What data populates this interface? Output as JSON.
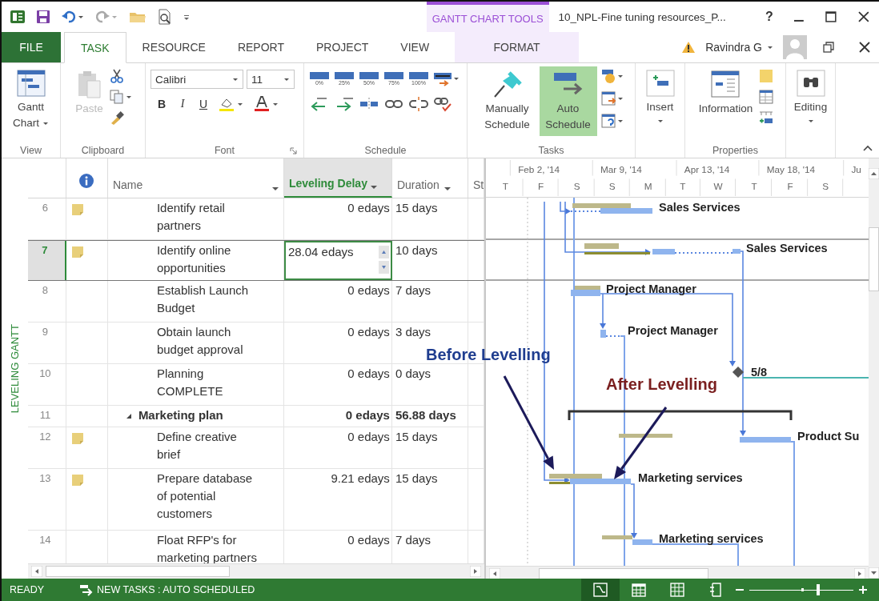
{
  "title_bar": {
    "context_label": "GANTT CHART TOOLS",
    "document_title": "10_NPL-Fine tuning resources_P...",
    "help": "?"
  },
  "tabs": [
    {
      "label": "FILE",
      "kind": "file",
      "selected": false
    },
    {
      "label": "TASK",
      "kind": "tab",
      "selected": true
    },
    {
      "label": "RESOURCE",
      "kind": "tab",
      "selected": false
    },
    {
      "label": "REPORT",
      "kind": "tab",
      "selected": false
    },
    {
      "label": "PROJECT",
      "kind": "tab",
      "selected": false
    },
    {
      "label": "VIEW",
      "kind": "tab",
      "selected": false
    },
    {
      "label": "FORMAT",
      "kind": "contextual",
      "selected": false
    }
  ],
  "account": {
    "user": "Ravindra G"
  },
  "ribbon": {
    "view": {
      "label": "View",
      "command": "Gantt Chart"
    },
    "clipboard": {
      "label": "Clipboard",
      "paste": "Paste",
      "paste_disabled": true
    },
    "font": {
      "label": "Font",
      "family": "Calibri",
      "size": "11",
      "bold": "B",
      "italic": "I",
      "underline": "U"
    },
    "schedule": {
      "label": "Schedule",
      "percents": [
        "0%",
        "25%",
        "50%",
        "75%",
        "100%"
      ]
    },
    "tasks": {
      "label": "Tasks",
      "modes": [
        {
          "label": "Manually Schedule",
          "selected": false
        },
        {
          "label": "Auto Schedule",
          "selected": true
        }
      ]
    },
    "insert": {
      "label": "Insert"
    },
    "properties": {
      "label": "Properties",
      "command": "Information"
    },
    "editing": {
      "label": "Editing"
    }
  },
  "view_bar": {
    "label": "LEVELING GANTT"
  },
  "table": {
    "columns": [
      {
        "label": "Name",
        "selected": false
      },
      {
        "label": "Leveling Delay",
        "selected": true
      },
      {
        "label": "Duration",
        "selected": false
      },
      {
        "label": "St",
        "selected": false
      }
    ],
    "rows": [
      {
        "id": "6",
        "note": true,
        "name": "Identify retail partners",
        "leveling_delay": "0 edays",
        "duration": "15 days",
        "selected": false,
        "editing": false,
        "summary": false
      },
      {
        "id": "7",
        "note": true,
        "name": "Identify online opportunities",
        "leveling_delay": "28.04 edays",
        "duration": "10 days",
        "selected": true,
        "editing": true,
        "summary": false
      },
      {
        "id": "8",
        "note": false,
        "name": "Establish Launch Budget",
        "leveling_delay": "0 edays",
        "duration": "7 days",
        "selected": false,
        "editing": false,
        "summary": false
      },
      {
        "id": "9",
        "note": false,
        "name": "Obtain launch budget approval",
        "leveling_delay": "0 edays",
        "duration": "3 days",
        "selected": false,
        "editing": false,
        "summary": false
      },
      {
        "id": "10",
        "note": false,
        "name": "Planning COMPLETE",
        "leveling_delay": "0 edays",
        "duration": "0 days",
        "selected": false,
        "editing": false,
        "summary": false
      },
      {
        "id": "11",
        "note": false,
        "name": "Marketing plan",
        "leveling_delay": "0 edays",
        "duration": "56.88 days",
        "selected": false,
        "editing": false,
        "summary": true,
        "expanded": true
      },
      {
        "id": "12",
        "note": true,
        "name": "Define creative brief",
        "leveling_delay": "0 edays",
        "duration": "15 days",
        "selected": false,
        "editing": false,
        "summary": false
      },
      {
        "id": "13",
        "note": true,
        "name": "Prepare database of potential customers",
        "leveling_delay": "9.21 edays",
        "duration": "15 days",
        "selected": false,
        "editing": false,
        "summary": false
      },
      {
        "id": "14",
        "note": false,
        "name": "Float RFP's for marketing partners",
        "leveling_delay": "0 edays",
        "duration": "7 days",
        "selected": false,
        "editing": false,
        "summary": false
      }
    ]
  },
  "gantt": {
    "timescale": {
      "major": [
        "Feb 2, '14",
        "Mar 9, '14",
        "Apr 13, '14",
        "May 18, '14",
        "Ju"
      ],
      "minor": [
        "T",
        "F",
        "S",
        "S",
        "M",
        "T",
        "W",
        "T",
        "F",
        "S"
      ]
    },
    "bar_labels": [
      "Sales Services",
      "Sales Services",
      "Project Manager",
      "Project Manager",
      "Product Su",
      "Marketing services",
      "Marketing services"
    ],
    "milestone_label": "5/8",
    "annotations": [
      {
        "kind": "before",
        "text": "Before Levelling"
      },
      {
        "kind": "after",
        "text": "After Levelling"
      }
    ]
  },
  "status_bar": {
    "mode": "READY",
    "new_tasks": "NEW TASKS : AUTO SCHEDULED",
    "views": [
      {
        "kind": "gantt",
        "selected": true
      },
      {
        "kind": "calendar",
        "selected": false
      },
      {
        "kind": "sheet",
        "selected": false
      },
      {
        "kind": "report",
        "selected": false
      }
    ],
    "zoom": {
      "level": 0.66
    }
  }
}
